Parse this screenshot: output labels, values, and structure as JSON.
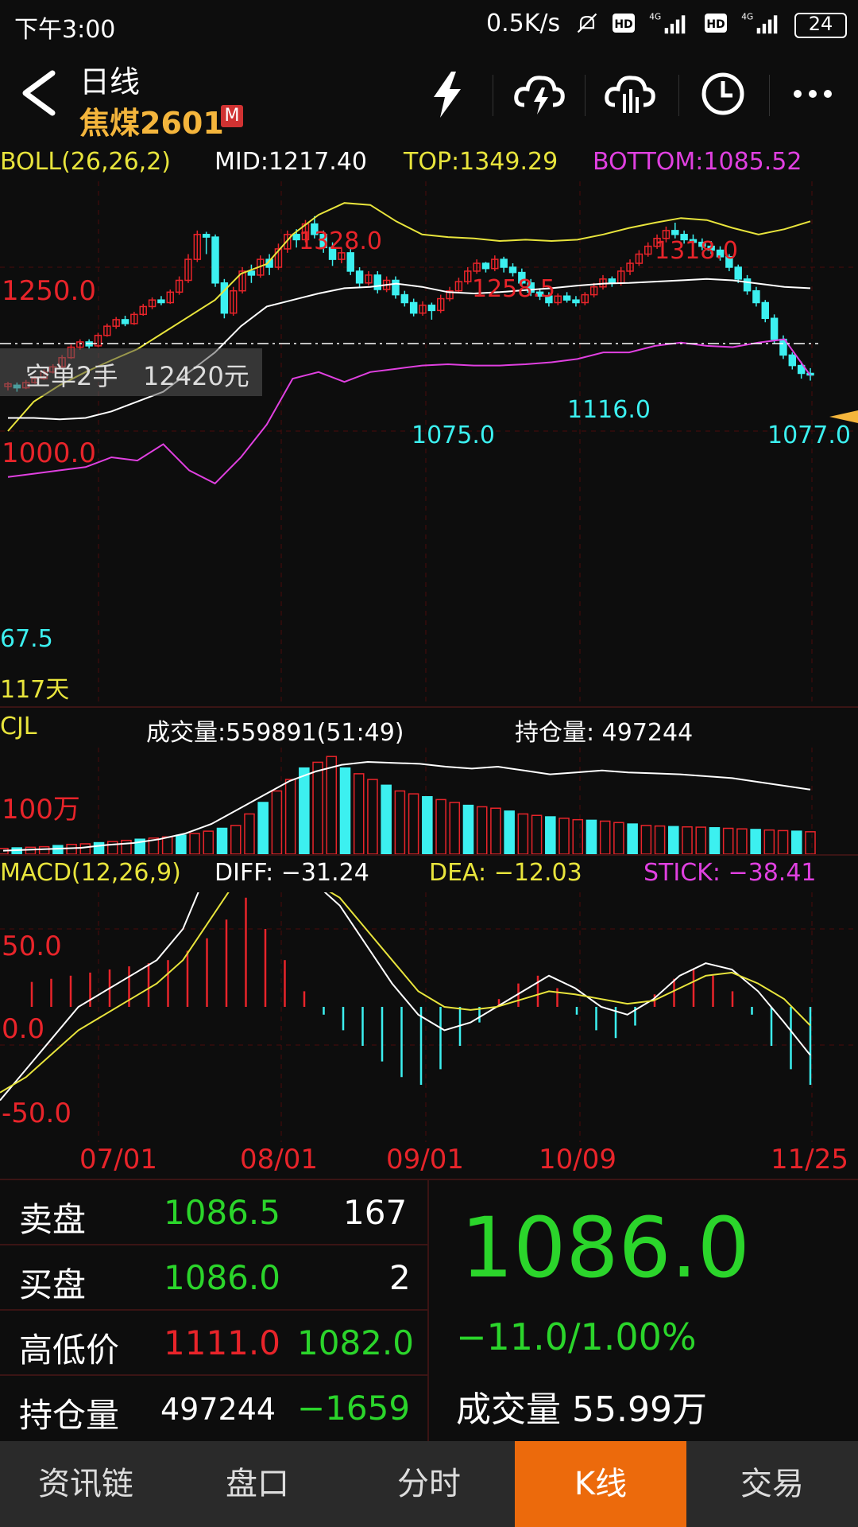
{
  "status_bar": {
    "time": "下午3:00",
    "net_speed": "0.5K/s",
    "battery": "24",
    "icons": [
      "mute-bell-icon",
      "hd-icon",
      "signal-4g-icon",
      "hd-icon",
      "signal-4g-icon",
      "battery-icon"
    ]
  },
  "header": {
    "period": "日线",
    "contract": "焦煤2601",
    "badge": "M",
    "toolbar_icons": [
      "lightning-icon",
      "cloud-lightning-icon",
      "cloud-chart-icon",
      "clock-icon",
      "more-icon"
    ]
  },
  "boll": {
    "label": "BOLL(26,26,2)",
    "mid": "MID:1217.40",
    "top": "TOP:1349.29",
    "bottom": "BOTTOM:1085.52"
  },
  "price_chart": {
    "axis_labels": [
      "1250.0",
      "1000.0"
    ],
    "annotations": [
      "1328.0",
      "1258.5",
      "1318.0",
      "1075.0",
      "1116.0",
      "1077.0",
      "67.5"
    ],
    "position_label": "空单2手",
    "position_value": "12420元",
    "days_label": "117天"
  },
  "cjl": {
    "label": "CJL",
    "volume": "成交量:559891(51:49)",
    "open_interest": "持仓量: 497244",
    "axis_label": "100万"
  },
  "macd": {
    "label": "MACD(12,26,9)",
    "diff": "DIFF: −31.24",
    "dea": "DEA: −12.03",
    "stick": "STICK: −38.41",
    "axis_labels": [
      "50.0",
      "0.0",
      "-50.0"
    ]
  },
  "date_axis": [
    "07/01",
    "08/01",
    "09/01",
    "10/09",
    "11/25"
  ],
  "quote_table": {
    "sell_label": "卖盘",
    "sell_price": "1086.5",
    "sell_qty": "167",
    "buy_label": "买盘",
    "buy_price": "1086.0",
    "buy_qty": "2",
    "hl_label": "高低价",
    "high": "1111.0",
    "low": "1082.0",
    "oi_label": "持仓量",
    "oi_value": "497244",
    "oi_change": "−1659"
  },
  "quote_summary": {
    "last_price": "1086.0",
    "change": "−11.0/1.00%",
    "volume": "成交量 55.99万"
  },
  "tabs": [
    "资讯链",
    "盘口",
    "分时",
    "K线",
    "交易"
  ],
  "active_tab": "K线",
  "colors": {
    "up": "#e8242a",
    "down": "#3cf0f0",
    "boll_top": "#e8e43c",
    "boll_mid": "#ffffff",
    "boll_bottom": "#e040e0",
    "accent": "#ec6a0c"
  },
  "chart_data": {
    "type": "candlestick",
    "candles": [
      [
        1068,
        1072,
        1062,
        1075
      ],
      [
        1070,
        1066,
        1060,
        1074
      ],
      [
        1066,
        1074,
        1064,
        1078
      ],
      [
        1074,
        1080,
        1072,
        1084
      ],
      [
        1080,
        1090,
        1078,
        1094
      ],
      [
        1090,
        1098,
        1088,
        1102
      ],
      [
        1098,
        1112,
        1096,
        1116
      ],
      [
        1112,
        1128,
        1110,
        1132
      ],
      [
        1128,
        1136,
        1124,
        1140
      ],
      [
        1136,
        1130,
        1126,
        1140
      ],
      [
        1130,
        1146,
        1128,
        1150
      ],
      [
        1146,
        1160,
        1144,
        1164
      ],
      [
        1160,
        1170,
        1156,
        1174
      ],
      [
        1170,
        1164,
        1160,
        1176
      ],
      [
        1164,
        1178,
        1162,
        1182
      ],
      [
        1178,
        1190,
        1176,
        1194
      ],
      [
        1190,
        1200,
        1186,
        1204
      ],
      [
        1200,
        1196,
        1192,
        1206
      ],
      [
        1196,
        1212,
        1194,
        1216
      ],
      [
        1212,
        1230,
        1208,
        1236
      ],
      [
        1230,
        1262,
        1226,
        1270
      ],
      [
        1262,
        1300,
        1258,
        1306
      ],
      [
        1300,
        1296,
        1270,
        1304
      ],
      [
        1296,
        1226,
        1220,
        1300
      ],
      [
        1226,
        1180,
        1172,
        1232
      ],
      [
        1180,
        1214,
        1176,
        1220
      ],
      [
        1214,
        1244,
        1210,
        1250
      ],
      [
        1244,
        1238,
        1226,
        1254
      ],
      [
        1238,
        1262,
        1234,
        1268
      ],
      [
        1262,
        1250,
        1238,
        1270
      ],
      [
        1250,
        1278,
        1246,
        1286
      ],
      [
        1278,
        1300,
        1272,
        1306
      ],
      [
        1300,
        1292,
        1280,
        1308
      ],
      [
        1292,
        1316,
        1288,
        1322
      ],
      [
        1316,
        1300,
        1294,
        1328
      ],
      [
        1300,
        1280,
        1272,
        1306
      ],
      [
        1280,
        1262,
        1252,
        1288
      ],
      [
        1262,
        1272,
        1256,
        1280
      ],
      [
        1272,
        1244,
        1238,
        1278
      ],
      [
        1244,
        1226,
        1220,
        1250
      ],
      [
        1226,
        1238,
        1222,
        1244
      ],
      [
        1238,
        1216,
        1210,
        1244
      ],
      [
        1216,
        1230,
        1212,
        1236
      ],
      [
        1230,
        1208,
        1202,
        1236
      ],
      [
        1208,
        1196,
        1190,
        1214
      ],
      [
        1196,
        1180,
        1175,
        1202
      ],
      [
        1180,
        1192,
        1176,
        1198
      ],
      [
        1192,
        1184,
        1170,
        1196
      ],
      [
        1184,
        1202,
        1180,
        1208
      ],
      [
        1202,
        1214,
        1198,
        1220
      ],
      [
        1214,
        1228,
        1210,
        1234
      ],
      [
        1228,
        1244,
        1224,
        1250
      ],
      [
        1244,
        1256,
        1240,
        1262
      ],
      [
        1256,
        1248,
        1242,
        1258
      ],
      [
        1248,
        1262,
        1244,
        1268
      ],
      [
        1262,
        1250,
        1242,
        1266
      ],
      [
        1250,
        1242,
        1236,
        1256
      ],
      [
        1242,
        1226,
        1220,
        1248
      ],
      [
        1226,
        1212,
        1206,
        1232
      ],
      [
        1212,
        1206,
        1200,
        1218
      ],
      [
        1206,
        1196,
        1190,
        1212
      ],
      [
        1196,
        1206,
        1192,
        1210
      ],
      [
        1206,
        1200,
        1196,
        1212
      ],
      [
        1200,
        1196,
        1190,
        1206
      ],
      [
        1196,
        1208,
        1192,
        1212
      ],
      [
        1208,
        1220,
        1204,
        1226
      ],
      [
        1220,
        1232,
        1216,
        1238
      ],
      [
        1232,
        1226,
        1220,
        1236
      ],
      [
        1226,
        1244,
        1222,
        1250
      ],
      [
        1244,
        1256,
        1238,
        1262
      ],
      [
        1256,
        1270,
        1252,
        1276
      ],
      [
        1270,
        1282,
        1266,
        1288
      ],
      [
        1282,
        1294,
        1278,
        1300
      ],
      [
        1294,
        1306,
        1288,
        1312
      ],
      [
        1306,
        1300,
        1294,
        1318
      ],
      [
        1300,
        1292,
        1286,
        1306
      ],
      [
        1292,
        1288,
        1282,
        1300
      ],
      [
        1288,
        1282,
        1276,
        1294
      ],
      [
        1282,
        1276,
        1270,
        1290
      ],
      [
        1276,
        1266,
        1260,
        1282
      ],
      [
        1266,
        1250,
        1244,
        1270
      ],
      [
        1250,
        1232,
        1226,
        1254
      ],
      [
        1232,
        1214,
        1208,
        1238
      ],
      [
        1214,
        1196,
        1190,
        1220
      ],
      [
        1196,
        1172,
        1166,
        1200
      ],
      [
        1172,
        1140,
        1134,
        1178
      ],
      [
        1140,
        1116,
        1110,
        1146
      ],
      [
        1116,
        1100,
        1094,
        1120
      ],
      [
        1100,
        1088,
        1080,
        1106
      ],
      [
        1088,
        1086,
        1077,
        1096
      ]
    ],
    "boll_top": [
      1000,
      1045,
      1070,
      1090,
      1108,
      1125,
      1150,
      1175,
      1200,
      1240,
      1255,
      1300,
      1330,
      1348,
      1345,
      1320,
      1300,
      1296,
      1294,
      1290,
      1292,
      1290,
      1292,
      1300,
      1310,
      1318,
      1325,
      1322,
      1310,
      1300,
      1308,
      1320
    ],
    "boll_mid": [
      1020,
      1020,
      1018,
      1020,
      1030,
      1045,
      1060,
      1090,
      1120,
      1160,
      1190,
      1200,
      1210,
      1218,
      1220,
      1225,
      1220,
      1212,
      1210,
      1212,
      1215,
      1218,
      1222,
      1225,
      1226,
      1228,
      1230,
      1232,
      1230,
      1225,
      1220,
      1218
    ],
    "boll_bot": [
      930,
      935,
      940,
      945,
      960,
      955,
      980,
      940,
      920,
      960,
      1010,
      1080,
      1090,
      1075,
      1090,
      1095,
      1100,
      1102,
      1100,
      1100,
      1102,
      1105,
      1110,
      1120,
      1120,
      1130,
      1135,
      1130,
      1128,
      1135,
      1140,
      1085
    ],
    "volume": [
      20,
      22,
      24,
      26,
      30,
      34,
      36,
      40,
      44,
      48,
      52,
      56,
      60,
      66,
      72,
      80,
      90,
      100,
      140,
      180,
      220,
      260,
      300,
      320,
      340,
      300,
      280,
      260,
      240,
      220,
      210,
      200,
      190,
      180,
      170,
      165,
      160,
      150,
      140,
      135,
      130,
      125,
      120,
      118,
      115,
      110,
      105,
      100,
      98,
      96,
      95,
      94,
      92,
      90,
      88,
      86,
      84,
      82,
      80,
      78
    ],
    "oi": [
      0.02,
      0.03,
      0.04,
      0.05,
      0.08,
      0.1,
      0.14,
      0.2,
      0.3,
      0.45,
      0.6,
      0.75,
      0.85,
      0.92,
      0.95,
      0.94,
      0.93,
      0.9,
      0.88,
      0.9,
      0.86,
      0.82,
      0.84,
      0.86,
      0.84,
      0.83,
      0.82,
      0.8,
      0.78,
      0.74,
      0.7,
      0.66
    ],
    "macd_hist": [
      16,
      18,
      20,
      22,
      24,
      26,
      28,
      30,
      36,
      44,
      56,
      70,
      50,
      30,
      10,
      -5,
      -15,
      -25,
      -35,
      -45,
      -50,
      -40,
      -25,
      -10,
      5,
      15,
      20,
      12,
      -5,
      -15,
      -20,
      -12,
      8,
      18,
      24,
      20,
      10,
      -5,
      -25,
      -40,
      -50
    ],
    "macd_diff": [
      -60,
      -40,
      -20,
      0,
      10,
      20,
      30,
      50,
      90,
      110,
      95,
      85,
      80,
      65,
      40,
      15,
      -5,
      -15,
      -10,
      0,
      10,
      20,
      12,
      0,
      -5,
      5,
      20,
      28,
      24,
      10,
      -10,
      -31
    ],
    "macd_dea": [
      -55,
      -45,
      -30,
      -15,
      -5,
      5,
      15,
      30,
      55,
      80,
      88,
      85,
      80,
      70,
      50,
      30,
      10,
      0,
      -2,
      0,
      5,
      10,
      8,
      5,
      2,
      4,
      12,
      20,
      22,
      15,
      5,
      -12
    ]
  }
}
